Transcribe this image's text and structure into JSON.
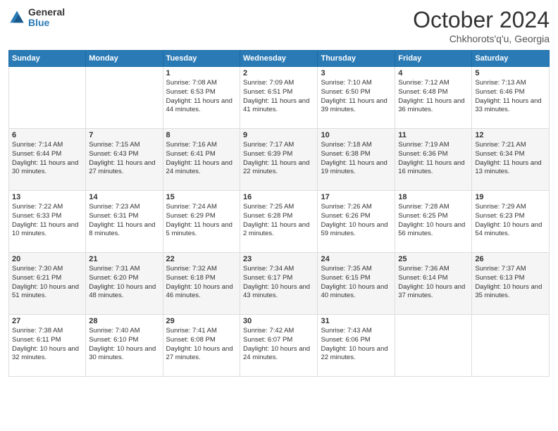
{
  "header": {
    "logo_general": "General",
    "logo_blue": "Blue",
    "month_title": "October 2024",
    "location": "Chkhorots'q'u, Georgia"
  },
  "weekdays": [
    "Sunday",
    "Monday",
    "Tuesday",
    "Wednesday",
    "Thursday",
    "Friday",
    "Saturday"
  ],
  "weeks": [
    [
      null,
      null,
      {
        "day": 1,
        "sunrise": "7:08 AM",
        "sunset": "6:53 PM",
        "daylight": "11 hours and 44 minutes."
      },
      {
        "day": 2,
        "sunrise": "7:09 AM",
        "sunset": "6:51 PM",
        "daylight": "11 hours and 41 minutes."
      },
      {
        "day": 3,
        "sunrise": "7:10 AM",
        "sunset": "6:50 PM",
        "daylight": "11 hours and 39 minutes."
      },
      {
        "day": 4,
        "sunrise": "7:12 AM",
        "sunset": "6:48 PM",
        "daylight": "11 hours and 36 minutes."
      },
      {
        "day": 5,
        "sunrise": "7:13 AM",
        "sunset": "6:46 PM",
        "daylight": "11 hours and 33 minutes."
      }
    ],
    [
      {
        "day": 6,
        "sunrise": "7:14 AM",
        "sunset": "6:44 PM",
        "daylight": "11 hours and 30 minutes."
      },
      {
        "day": 7,
        "sunrise": "7:15 AM",
        "sunset": "6:43 PM",
        "daylight": "11 hours and 27 minutes."
      },
      {
        "day": 8,
        "sunrise": "7:16 AM",
        "sunset": "6:41 PM",
        "daylight": "11 hours and 24 minutes."
      },
      {
        "day": 9,
        "sunrise": "7:17 AM",
        "sunset": "6:39 PM",
        "daylight": "11 hours and 22 minutes."
      },
      {
        "day": 10,
        "sunrise": "7:18 AM",
        "sunset": "6:38 PM",
        "daylight": "11 hours and 19 minutes."
      },
      {
        "day": 11,
        "sunrise": "7:19 AM",
        "sunset": "6:36 PM",
        "daylight": "11 hours and 16 minutes."
      },
      {
        "day": 12,
        "sunrise": "7:21 AM",
        "sunset": "6:34 PM",
        "daylight": "11 hours and 13 minutes."
      }
    ],
    [
      {
        "day": 13,
        "sunrise": "7:22 AM",
        "sunset": "6:33 PM",
        "daylight": "11 hours and 10 minutes."
      },
      {
        "day": 14,
        "sunrise": "7:23 AM",
        "sunset": "6:31 PM",
        "daylight": "11 hours and 8 minutes."
      },
      {
        "day": 15,
        "sunrise": "7:24 AM",
        "sunset": "6:29 PM",
        "daylight": "11 hours and 5 minutes."
      },
      {
        "day": 16,
        "sunrise": "7:25 AM",
        "sunset": "6:28 PM",
        "daylight": "11 hours and 2 minutes."
      },
      {
        "day": 17,
        "sunrise": "7:26 AM",
        "sunset": "6:26 PM",
        "daylight": "10 hours and 59 minutes."
      },
      {
        "day": 18,
        "sunrise": "7:28 AM",
        "sunset": "6:25 PM",
        "daylight": "10 hours and 56 minutes."
      },
      {
        "day": 19,
        "sunrise": "7:29 AM",
        "sunset": "6:23 PM",
        "daylight": "10 hours and 54 minutes."
      }
    ],
    [
      {
        "day": 20,
        "sunrise": "7:30 AM",
        "sunset": "6:21 PM",
        "daylight": "10 hours and 51 minutes."
      },
      {
        "day": 21,
        "sunrise": "7:31 AM",
        "sunset": "6:20 PM",
        "daylight": "10 hours and 48 minutes."
      },
      {
        "day": 22,
        "sunrise": "7:32 AM",
        "sunset": "6:18 PM",
        "daylight": "10 hours and 46 minutes."
      },
      {
        "day": 23,
        "sunrise": "7:34 AM",
        "sunset": "6:17 PM",
        "daylight": "10 hours and 43 minutes."
      },
      {
        "day": 24,
        "sunrise": "7:35 AM",
        "sunset": "6:15 PM",
        "daylight": "10 hours and 40 minutes."
      },
      {
        "day": 25,
        "sunrise": "7:36 AM",
        "sunset": "6:14 PM",
        "daylight": "10 hours and 37 minutes."
      },
      {
        "day": 26,
        "sunrise": "7:37 AM",
        "sunset": "6:13 PM",
        "daylight": "10 hours and 35 minutes."
      }
    ],
    [
      {
        "day": 27,
        "sunrise": "7:38 AM",
        "sunset": "6:11 PM",
        "daylight": "10 hours and 32 minutes."
      },
      {
        "day": 28,
        "sunrise": "7:40 AM",
        "sunset": "6:10 PM",
        "daylight": "10 hours and 30 minutes."
      },
      {
        "day": 29,
        "sunrise": "7:41 AM",
        "sunset": "6:08 PM",
        "daylight": "10 hours and 27 minutes."
      },
      {
        "day": 30,
        "sunrise": "7:42 AM",
        "sunset": "6:07 PM",
        "daylight": "10 hours and 24 minutes."
      },
      {
        "day": 31,
        "sunrise": "7:43 AM",
        "sunset": "6:06 PM",
        "daylight": "10 hours and 22 minutes."
      },
      null,
      null
    ]
  ],
  "labels": {
    "sunrise": "Sunrise:",
    "sunset": "Sunset:",
    "daylight": "Daylight:"
  }
}
